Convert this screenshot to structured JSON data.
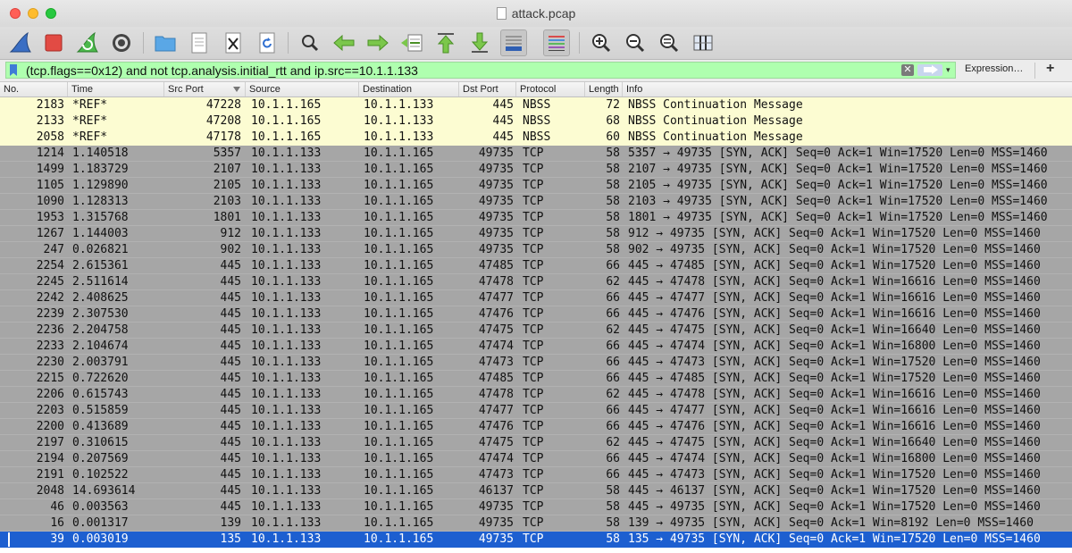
{
  "window": {
    "title": "attack.pcap"
  },
  "toolbar": {
    "buttons": [
      {
        "name": "start-capture-icon",
        "icon": "shark-fin"
      },
      {
        "name": "stop-capture-icon",
        "icon": "red-square"
      },
      {
        "name": "restart-capture-icon",
        "icon": "green-fin"
      },
      {
        "name": "capture-options-icon",
        "icon": "gear"
      },
      {
        "name": "open-file-icon",
        "icon": "folder"
      },
      {
        "name": "save-file-icon",
        "icon": "document"
      },
      {
        "name": "close-file-icon",
        "icon": "document-x"
      },
      {
        "name": "reload-file-icon",
        "icon": "reload"
      },
      {
        "name": "find-packet-icon",
        "icon": "magnifier"
      },
      {
        "name": "go-back-icon",
        "icon": "arrow-left"
      },
      {
        "name": "go-forward-icon",
        "icon": "arrow-right"
      },
      {
        "name": "go-to-packet-icon",
        "icon": "go-to"
      },
      {
        "name": "go-first-icon",
        "icon": "arrow-up"
      },
      {
        "name": "go-last-icon",
        "icon": "arrow-down"
      },
      {
        "name": "autoscroll-icon",
        "icon": "autoscroll"
      },
      {
        "name": "colorize-icon",
        "icon": "colorize"
      },
      {
        "name": "zoom-in-icon",
        "icon": "zoom-in"
      },
      {
        "name": "zoom-out-icon",
        "icon": "zoom-out"
      },
      {
        "name": "normal-size-icon",
        "icon": "zoom-normal"
      },
      {
        "name": "resize-columns-icon",
        "icon": "resize-columns"
      }
    ]
  },
  "filter": {
    "text": "(tcp.flags==0x12) and not tcp.analysis.initial_rtt and ip.src==10.1.1.133",
    "clear_symbol": "✕",
    "dropdown_symbol": "▾",
    "expression_label": "Expression…",
    "add_label": "+",
    "bg_color": "#afffaf"
  },
  "columns": [
    "No.",
    "Time",
    "Src Port",
    "Source",
    "Destination",
    "Dst Port",
    "Protocol",
    "Length",
    "Info"
  ],
  "colors": {
    "ref_row": "#fcfcd2",
    "tcp_row": "#a6a6a6",
    "selected_row": "#1d5fd0"
  },
  "rows": [
    {
      "no": "2183",
      "time": "*REF*",
      "sport": "47228",
      "src": "10.1.1.165",
      "dst": "10.1.1.133",
      "dport": "445",
      "proto": "NBSS",
      "len": "72",
      "info": "NBSS Continuation Message",
      "style": "ref"
    },
    {
      "no": "2133",
      "time": "*REF*",
      "sport": "47208",
      "src": "10.1.1.165",
      "dst": "10.1.1.133",
      "dport": "445",
      "proto": "NBSS",
      "len": "68",
      "info": "NBSS Continuation Message",
      "style": "ref"
    },
    {
      "no": "2058",
      "time": "*REF*",
      "sport": "47178",
      "src": "10.1.1.165",
      "dst": "10.1.1.133",
      "dport": "445",
      "proto": "NBSS",
      "len": "60",
      "info": "NBSS Continuation Message",
      "style": "ref"
    },
    {
      "no": "1214",
      "time": "1.140518",
      "sport": "5357",
      "src": "10.1.1.133",
      "dst": "10.1.1.165",
      "dport": "49735",
      "proto": "TCP",
      "len": "58",
      "info": "5357 → 49735 [SYN, ACK] Seq=0 Ack=1 Win=17520 Len=0 MSS=1460",
      "style": "tcp"
    },
    {
      "no": "1499",
      "time": "1.183729",
      "sport": "2107",
      "src": "10.1.1.133",
      "dst": "10.1.1.165",
      "dport": "49735",
      "proto": "TCP",
      "len": "58",
      "info": "2107 → 49735 [SYN, ACK] Seq=0 Ack=1 Win=17520 Len=0 MSS=1460",
      "style": "tcp"
    },
    {
      "no": "1105",
      "time": "1.129890",
      "sport": "2105",
      "src": "10.1.1.133",
      "dst": "10.1.1.165",
      "dport": "49735",
      "proto": "TCP",
      "len": "58",
      "info": "2105 → 49735 [SYN, ACK] Seq=0 Ack=1 Win=17520 Len=0 MSS=1460",
      "style": "tcp"
    },
    {
      "no": "1090",
      "time": "1.128313",
      "sport": "2103",
      "src": "10.1.1.133",
      "dst": "10.1.1.165",
      "dport": "49735",
      "proto": "TCP",
      "len": "58",
      "info": "2103 → 49735 [SYN, ACK] Seq=0 Ack=1 Win=17520 Len=0 MSS=1460",
      "style": "tcp"
    },
    {
      "no": "1953",
      "time": "1.315768",
      "sport": "1801",
      "src": "10.1.1.133",
      "dst": "10.1.1.165",
      "dport": "49735",
      "proto": "TCP",
      "len": "58",
      "info": "1801 → 49735 [SYN, ACK] Seq=0 Ack=1 Win=17520 Len=0 MSS=1460",
      "style": "tcp"
    },
    {
      "no": "1267",
      "time": "1.144003",
      "sport": "912",
      "src": "10.1.1.133",
      "dst": "10.1.1.165",
      "dport": "49735",
      "proto": "TCP",
      "len": "58",
      "info": "912 → 49735 [SYN, ACK] Seq=0 Ack=1 Win=17520 Len=0 MSS=1460",
      "style": "tcp"
    },
    {
      "no": "247",
      "time": "0.026821",
      "sport": "902",
      "src": "10.1.1.133",
      "dst": "10.1.1.165",
      "dport": "49735",
      "proto": "TCP",
      "len": "58",
      "info": "902 → 49735 [SYN, ACK] Seq=0 Ack=1 Win=17520 Len=0 MSS=1460",
      "style": "tcp"
    },
    {
      "no": "2254",
      "time": "2.615361",
      "sport": "445",
      "src": "10.1.1.133",
      "dst": "10.1.1.165",
      "dport": "47485",
      "proto": "TCP",
      "len": "66",
      "info": "445 → 47485 [SYN, ACK] Seq=0 Ack=1 Win=17520 Len=0 MSS=1460",
      "style": "tcp"
    },
    {
      "no": "2245",
      "time": "2.511614",
      "sport": "445",
      "src": "10.1.1.133",
      "dst": "10.1.1.165",
      "dport": "47478",
      "proto": "TCP",
      "len": "62",
      "info": "445 → 47478 [SYN, ACK] Seq=0 Ack=1 Win=16616 Len=0 MSS=1460",
      "style": "tcp"
    },
    {
      "no": "2242",
      "time": "2.408625",
      "sport": "445",
      "src": "10.1.1.133",
      "dst": "10.1.1.165",
      "dport": "47477",
      "proto": "TCP",
      "len": "66",
      "info": "445 → 47477 [SYN, ACK] Seq=0 Ack=1 Win=16616 Len=0 MSS=1460",
      "style": "tcp"
    },
    {
      "no": "2239",
      "time": "2.307530",
      "sport": "445",
      "src": "10.1.1.133",
      "dst": "10.1.1.165",
      "dport": "47476",
      "proto": "TCP",
      "len": "66",
      "info": "445 → 47476 [SYN, ACK] Seq=0 Ack=1 Win=16616 Len=0 MSS=1460",
      "style": "tcp"
    },
    {
      "no": "2236",
      "time": "2.204758",
      "sport": "445",
      "src": "10.1.1.133",
      "dst": "10.1.1.165",
      "dport": "47475",
      "proto": "TCP",
      "len": "62",
      "info": "445 → 47475 [SYN, ACK] Seq=0 Ack=1 Win=16640 Len=0 MSS=1460",
      "style": "tcp"
    },
    {
      "no": "2233",
      "time": "2.104674",
      "sport": "445",
      "src": "10.1.1.133",
      "dst": "10.1.1.165",
      "dport": "47474",
      "proto": "TCP",
      "len": "66",
      "info": "445 → 47474 [SYN, ACK] Seq=0 Ack=1 Win=16800 Len=0 MSS=1460",
      "style": "tcp"
    },
    {
      "no": "2230",
      "time": "2.003791",
      "sport": "445",
      "src": "10.1.1.133",
      "dst": "10.1.1.165",
      "dport": "47473",
      "proto": "TCP",
      "len": "66",
      "info": "445 → 47473 [SYN, ACK] Seq=0 Ack=1 Win=17520 Len=0 MSS=1460",
      "style": "tcp"
    },
    {
      "no": "2215",
      "time": "0.722620",
      "sport": "445",
      "src": "10.1.1.133",
      "dst": "10.1.1.165",
      "dport": "47485",
      "proto": "TCP",
      "len": "66",
      "info": "445 → 47485 [SYN, ACK] Seq=0 Ack=1 Win=17520 Len=0 MSS=1460",
      "style": "tcp"
    },
    {
      "no": "2206",
      "time": "0.615743",
      "sport": "445",
      "src": "10.1.1.133",
      "dst": "10.1.1.165",
      "dport": "47478",
      "proto": "TCP",
      "len": "62",
      "info": "445 → 47478 [SYN, ACK] Seq=0 Ack=1 Win=16616 Len=0 MSS=1460",
      "style": "tcp"
    },
    {
      "no": "2203",
      "time": "0.515859",
      "sport": "445",
      "src": "10.1.1.133",
      "dst": "10.1.1.165",
      "dport": "47477",
      "proto": "TCP",
      "len": "66",
      "info": "445 → 47477 [SYN, ACK] Seq=0 Ack=1 Win=16616 Len=0 MSS=1460",
      "style": "tcp"
    },
    {
      "no": "2200",
      "time": "0.413689",
      "sport": "445",
      "src": "10.1.1.133",
      "dst": "10.1.1.165",
      "dport": "47476",
      "proto": "TCP",
      "len": "66",
      "info": "445 → 47476 [SYN, ACK] Seq=0 Ack=1 Win=16616 Len=0 MSS=1460",
      "style": "tcp"
    },
    {
      "no": "2197",
      "time": "0.310615",
      "sport": "445",
      "src": "10.1.1.133",
      "dst": "10.1.1.165",
      "dport": "47475",
      "proto": "TCP",
      "len": "62",
      "info": "445 → 47475 [SYN, ACK] Seq=0 Ack=1 Win=16640 Len=0 MSS=1460",
      "style": "tcp"
    },
    {
      "no": "2194",
      "time": "0.207569",
      "sport": "445",
      "src": "10.1.1.133",
      "dst": "10.1.1.165",
      "dport": "47474",
      "proto": "TCP",
      "len": "66",
      "info": "445 → 47474 [SYN, ACK] Seq=0 Ack=1 Win=16800 Len=0 MSS=1460",
      "style": "tcp"
    },
    {
      "no": "2191",
      "time": "0.102522",
      "sport": "445",
      "src": "10.1.1.133",
      "dst": "10.1.1.165",
      "dport": "47473",
      "proto": "TCP",
      "len": "66",
      "info": "445 → 47473 [SYN, ACK] Seq=0 Ack=1 Win=17520 Len=0 MSS=1460",
      "style": "tcp"
    },
    {
      "no": "2048",
      "time": "14.693614",
      "sport": "445",
      "src": "10.1.1.133",
      "dst": "10.1.1.165",
      "dport": "46137",
      "proto": "TCP",
      "len": "58",
      "info": "445 → 46137 [SYN, ACK] Seq=0 Ack=1 Win=17520 Len=0 MSS=1460",
      "style": "tcp"
    },
    {
      "no": "46",
      "time": "0.003563",
      "sport": "445",
      "src": "10.1.1.133",
      "dst": "10.1.1.165",
      "dport": "49735",
      "proto": "TCP",
      "len": "58",
      "info": "445 → 49735 [SYN, ACK] Seq=0 Ack=1 Win=17520 Len=0 MSS=1460",
      "style": "tcp"
    },
    {
      "no": "16",
      "time": "0.001317",
      "sport": "139",
      "src": "10.1.1.133",
      "dst": "10.1.1.165",
      "dport": "49735",
      "proto": "TCP",
      "len": "58",
      "info": "139 → 49735 [SYN, ACK] Seq=0 Ack=1 Win=8192 Len=0 MSS=1460",
      "style": "tcp"
    },
    {
      "no": "39",
      "time": "0.003019",
      "sport": "135",
      "src": "10.1.1.133",
      "dst": "10.1.1.165",
      "dport": "49735",
      "proto": "TCP",
      "len": "58",
      "info": "135 → 49735 [SYN, ACK] Seq=0 Ack=1 Win=17520 Len=0 MSS=1460",
      "style": "sel"
    }
  ]
}
